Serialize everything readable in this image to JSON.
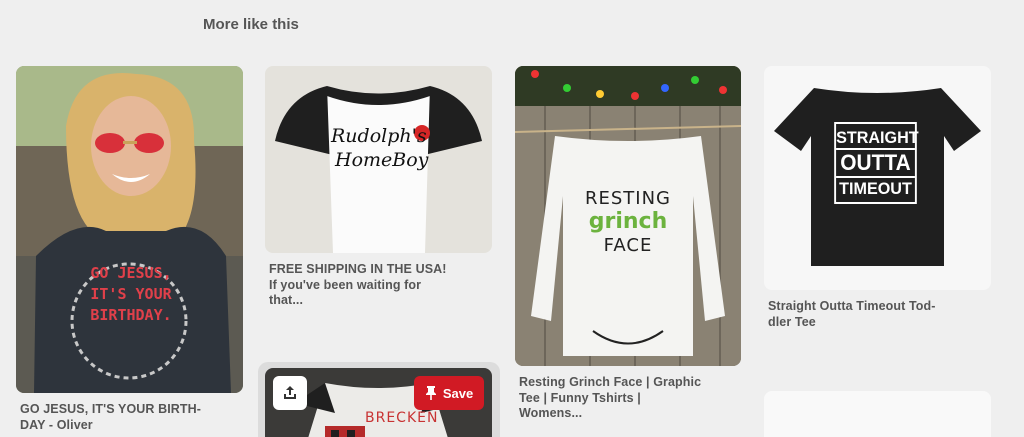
{
  "section": {
    "title": "More like this"
  },
  "pins": [
    {
      "caption_line1": "GO JESUS, IT'S YOUR BIRTH-",
      "caption_line2": "DAY - Oliver",
      "shirt_text": [
        "GO JESUS,",
        "IT'S YOUR",
        "BIRTHDAY."
      ]
    },
    {
      "caption_line1": "FREE SHIPPING IN THE USA!",
      "caption_line2": "If you've been waiting for",
      "caption_line3": "that...",
      "shirt_text": [
        "Rudolph's",
        "HomeBoy"
      ]
    },
    {
      "caption_line1": "Resting Grinch Face | Graphic",
      "caption_line2": "Tee | Funny Tshirts |",
      "caption_line3": "Womens...",
      "shirt_text": [
        "RESTING",
        "grinch",
        "FACE"
      ]
    },
    {
      "caption_line1": "Straight Outta Timeout Tod-",
      "caption_line2": "dler Tee",
      "shirt_text": [
        "STRAIGHT",
        "OUTTA",
        "TIMEOUT"
      ]
    },
    {
      "shirt_text": [
        "BRECKEN"
      ]
    }
  ],
  "hover_actions": {
    "save_label": "Save",
    "share_icon": "share-icon",
    "pin_icon": "pushpin-icon"
  },
  "colors": {
    "save_red": "#d11a24",
    "background": "#efefef"
  }
}
